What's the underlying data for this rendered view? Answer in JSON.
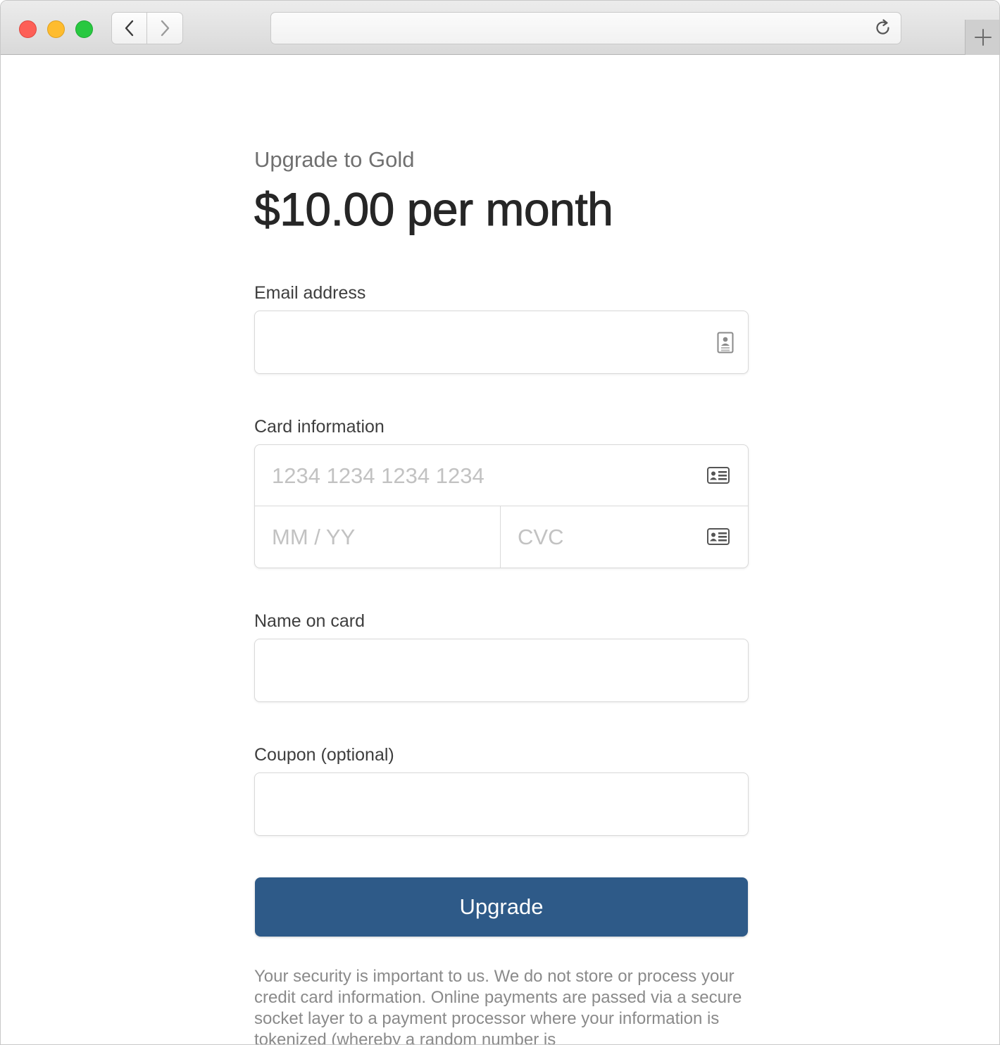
{
  "browser": {
    "back_icon": "chevron-left-icon",
    "forward_icon": "chevron-right-icon",
    "url": "",
    "reload_icon": "reload-icon",
    "new_tab_icon": "plus-icon"
  },
  "page": {
    "subtitle": "Upgrade to Gold",
    "price": "$10.00 per month",
    "email": {
      "label": "Email address",
      "value": "",
      "icon": "contact-card-icon"
    },
    "card": {
      "label": "Card information",
      "number_placeholder": "1234 1234 1234 1234",
      "expiry_placeholder": "MM / YY",
      "cvc_placeholder": "CVC",
      "icon": "credit-card-icon"
    },
    "name": {
      "label": "Name on card",
      "value": ""
    },
    "coupon": {
      "label": "Coupon (optional)",
      "value": ""
    },
    "submit_label": "Upgrade",
    "security_text": "Your security is important to us. We do not store or process your credit card information. Online payments are passed via a secure socket layer to a payment processor where your information is tokenized (whereby a random number is"
  },
  "colors": {
    "button": "#2e5a88",
    "close": "#fd5f57",
    "minimize": "#febc2e",
    "maximize": "#28c840"
  }
}
